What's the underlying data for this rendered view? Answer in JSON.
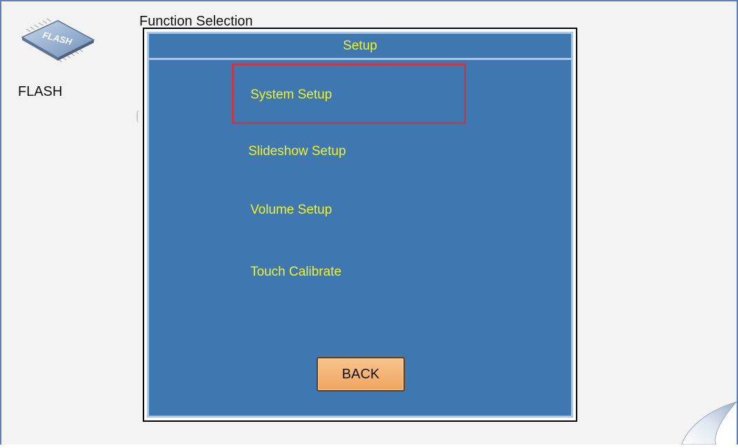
{
  "screen": {
    "header": "Function Selection",
    "flash_icon": {
      "name": "flash-chip-icon",
      "text": "FLASH"
    },
    "flash_label": "FLASH"
  },
  "dialog": {
    "title": "Setup",
    "items": [
      {
        "label": "System Setup",
        "selected": true
      },
      {
        "label": "Slideshow Setup",
        "selected": false
      },
      {
        "label": "Volume Setup",
        "selected": false
      },
      {
        "label": "Touch Calibrate",
        "selected": false
      }
    ],
    "back_label": "BACK"
  },
  "colors": {
    "dialog_bg": "#3f78b0",
    "dialog_border": "#a9c8ea",
    "menu_text": "#f2f22c",
    "selection_border": "#c23a4a",
    "button_bg": "#f0a55f",
    "screen_bg": "#f3f3f3"
  }
}
